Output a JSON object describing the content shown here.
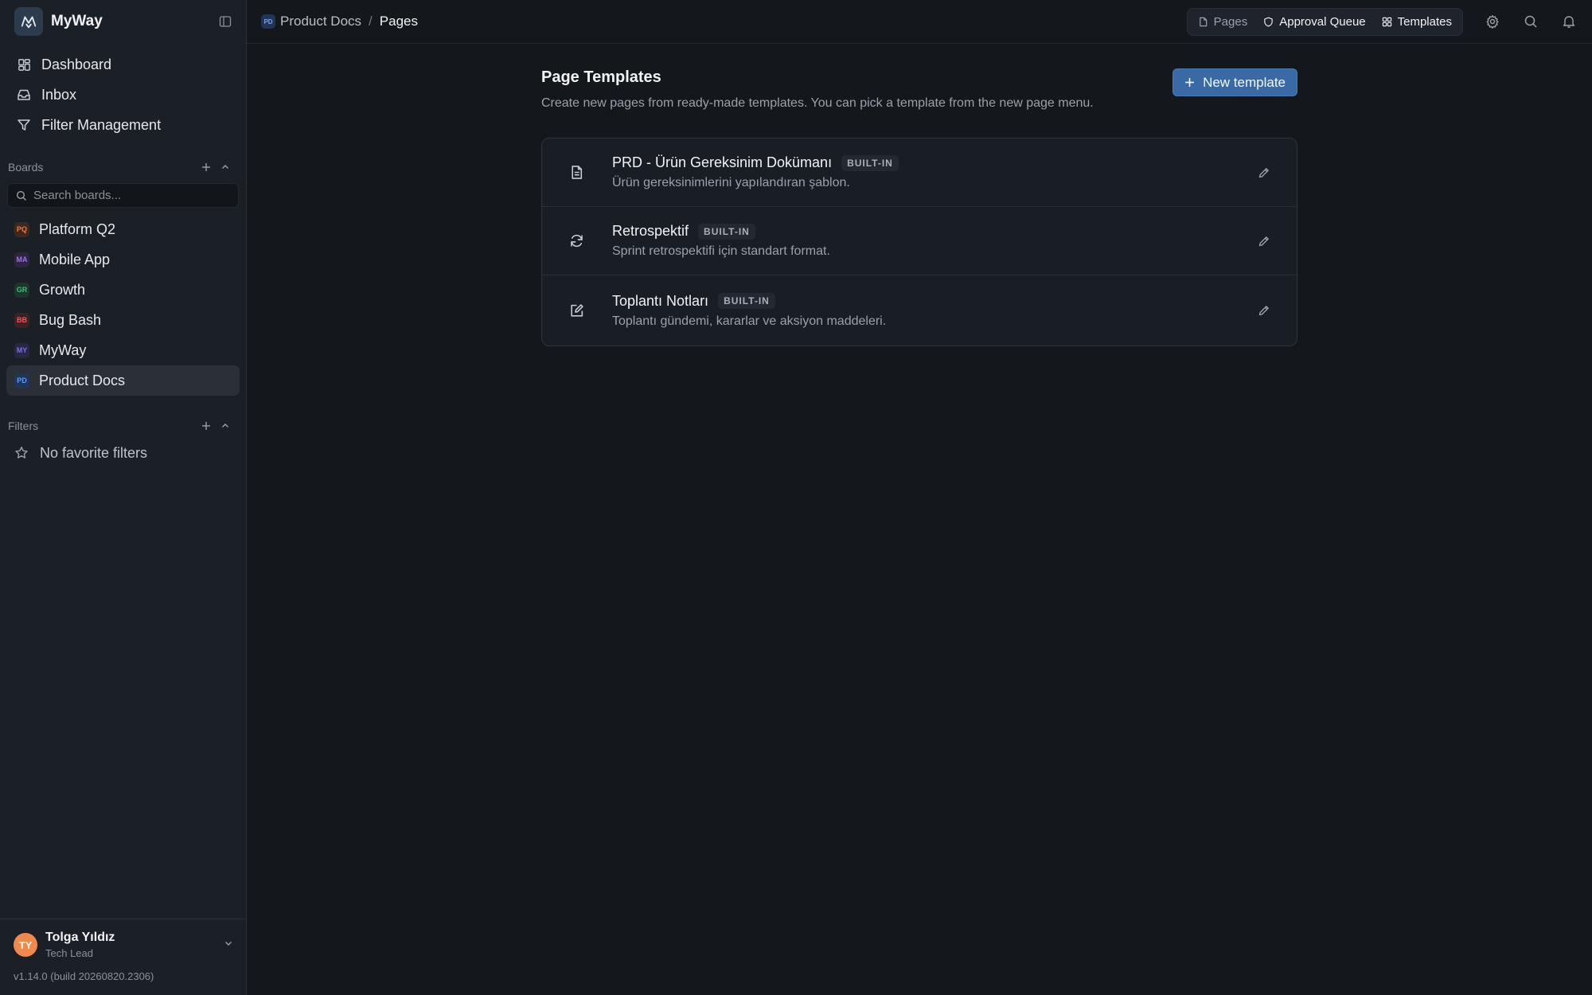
{
  "app": {
    "name": "MyWay"
  },
  "nav": [
    {
      "label": "Dashboard",
      "icon": "dashboard-icon"
    },
    {
      "label": "Inbox",
      "icon": "inbox-icon"
    },
    {
      "label": "Filter Management",
      "icon": "filter-icon"
    }
  ],
  "boards": {
    "title": "Boards",
    "search_placeholder": "Search boards...",
    "items": [
      {
        "code": "PQ",
        "label": "Platform Q2",
        "color": "#f07a3a",
        "bg": "#3a2a22"
      },
      {
        "code": "MA",
        "label": "Mobile App",
        "color": "#a56cf0",
        "bg": "#2e2640"
      },
      {
        "code": "GR",
        "label": "Growth",
        "color": "#33c07a",
        "bg": "#1f3529"
      },
      {
        "code": "BB",
        "label": "Bug Bash",
        "color": "#ef5a5a",
        "bg": "#3b2226"
      },
      {
        "code": "MY",
        "label": "MyWay",
        "color": "#7a6cf0",
        "bg": "#2a2744"
      },
      {
        "code": "PD",
        "label": "Product Docs",
        "color": "#5a9aff",
        "bg": "#223554"
      }
    ],
    "active_index": 5
  },
  "filters": {
    "title": "Filters",
    "empty_label": "No favorite filters"
  },
  "user": {
    "initials": "TY",
    "name": "Tolga Yıldız",
    "role": "Tech Lead",
    "version": "v1.14.0 (build 20260820.2306)"
  },
  "breadcrumb": {
    "badge": "PD",
    "parent": "Product Docs",
    "separator": "/",
    "current": "Pages"
  },
  "top_tabs": [
    {
      "label": "Pages",
      "icon": "document-icon",
      "active": false
    },
    {
      "label": "Approval Queue",
      "icon": "shield-icon",
      "active": true
    },
    {
      "label": "Templates",
      "icon": "grid-icon",
      "active": true
    }
  ],
  "page": {
    "title": "Page Templates",
    "subtitle": "Create new pages from ready-made templates. You can pick a template from the new page menu.",
    "new_button": "New template"
  },
  "templates": [
    {
      "name": "PRD - Ürün Gereksinim Dokümanı",
      "badge": "BUILT-IN",
      "desc": "Ürün gereksinimlerini yapılandıran şablon.",
      "icon": "document-icon"
    },
    {
      "name": "Retrospektif",
      "badge": "BUILT-IN",
      "desc": "Sprint retrospektifi için standart format.",
      "icon": "refresh-icon"
    },
    {
      "name": "Toplantı Notları",
      "badge": "BUILT-IN",
      "desc": "Toplantı gündemi, kararlar ve aksiyon maddeleri.",
      "icon": "edit-note-icon"
    }
  ],
  "colors": {
    "accent": "#3a6aa5",
    "background": "#14171c",
    "sidebar": "#1b1f26"
  }
}
